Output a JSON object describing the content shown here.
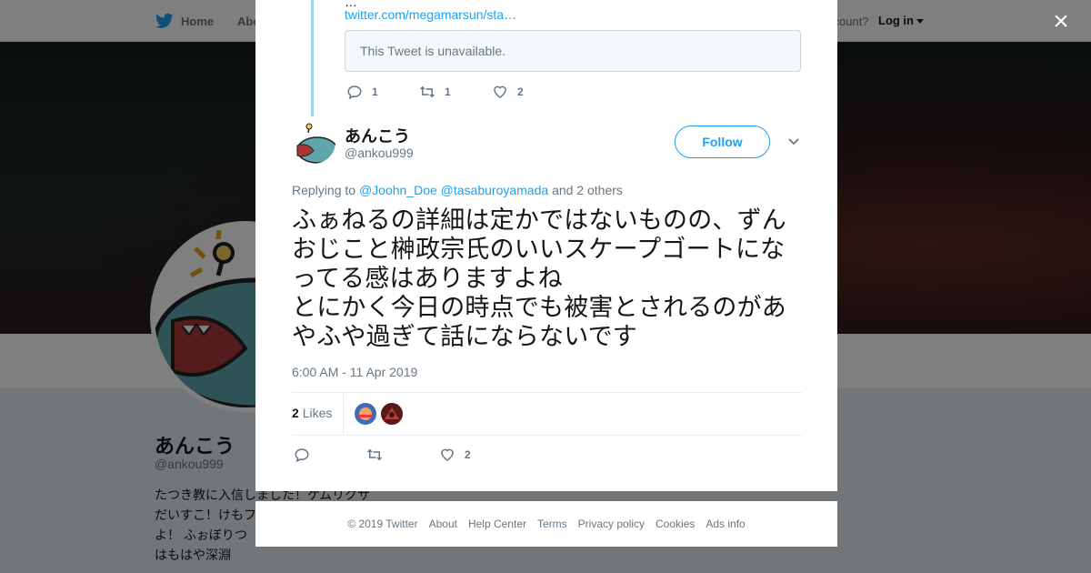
{
  "nav": {
    "home_label": "Home",
    "about_label": "Abo",
    "account_prompt": "ccount?",
    "login_label": "Log in"
  },
  "profile": {
    "name": "あんこう",
    "handle": "@ankou999",
    "bio": "たつき教に入信しました！ケムリクサ\nだいすこ！けもフ\nよ！ ふぉぼりつ\nはもはや深淵"
  },
  "close_label": "×",
  "previous_tweet": {
    "text_fragment": "…",
    "link": "twitter.com/megamarsun/sta…",
    "quote_unavailable": "This Tweet is unavailable.",
    "replies": "1",
    "retweets": "1",
    "likes": "2"
  },
  "tweet": {
    "name": "あんこう",
    "handle": "@ankou999",
    "follow_label": "Follow",
    "replying_prefix": "Replying to",
    "replying_mention_1": "@Joohn_Doe",
    "replying_mention_2": "@tasaburoyamada",
    "replying_suffix": "and 2 others",
    "text": "ふぁねるの詳細は定かではないものの、ずんおじこと榊政宗氏のいいスケープゴートになってる感はありますよね\nとにかく今日の時点でも被害とされるのがあやふや過ぎて話にならないです",
    "timestamp": "6:00 AM - 11 Apr 2019",
    "likes_count": "2",
    "likes_label": "Likes",
    "action_likes": "2",
    "accent_color": "#1da1f2"
  },
  "footer": {
    "copyright": "© 2019 Twitter",
    "about": "About",
    "help": "Help Center",
    "terms": "Terms",
    "privacy": "Privacy policy",
    "cookies": "Cookies",
    "ads": "Ads info"
  },
  "icons": [
    "twitter-bird-icon",
    "reply-icon",
    "retweet-icon",
    "heart-icon",
    "chevron-down-icon",
    "close-icon"
  ]
}
